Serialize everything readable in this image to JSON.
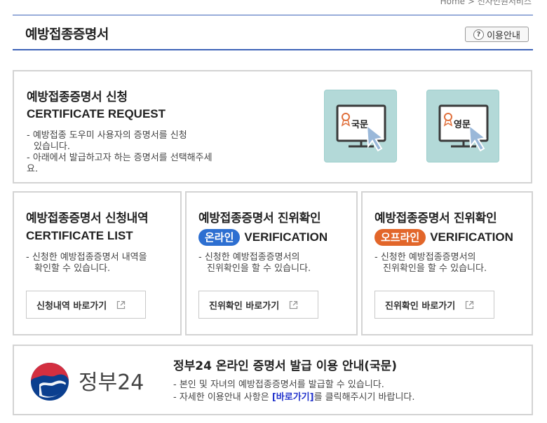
{
  "breadcrumb": "Home > 전자민원서비스",
  "page": {
    "title": "예방접종증명서",
    "guide_button": "이용안내",
    "guide_icon": "?"
  },
  "request": {
    "title": "예방접종증명서 신청",
    "title_en": "CERTIFICATE REQUEST",
    "desc_line1": "- 예방접종 도우미 사용자의 증명서를 신청",
    "desc_line1b": "  있습니다.",
    "desc_line2": "- 아래에서 발급하고자 하는 증명서를 선택해주세",
    "desc_line2b": "요.",
    "tiles": [
      {
        "label": "국문",
        "icon": "monitor-certificate-icon"
      },
      {
        "label": "영문",
        "icon": "monitor-certificate-icon"
      }
    ]
  },
  "cards": {
    "list": {
      "title": "예방접종증명서 신청내역",
      "title_en": "CERTIFICATE LIST",
      "desc_line1": "- 신청한 예방접종증명서 내역을",
      "desc_line2": "  확인할 수 있습니다.",
      "button": "신청내역 바로가기"
    },
    "online": {
      "title": "예방접종증명서 진위확인",
      "badge": "온라인",
      "title_en": "VERIFICATION",
      "desc_line1": "- 신청한 예방접종증명서의",
      "desc_line2": "  진위확인을 할 수 있습니다.",
      "button": "진위확인 바로가기"
    },
    "offline": {
      "title": "예방접종증명서 진위확인",
      "badge": "오프라인",
      "title_en": "VERIFICATION",
      "desc_line1": "- 신청한 예방접종증명서의",
      "desc_line2": "  진위확인을 할 수 있습니다.",
      "button": "진위확인 바로가기"
    }
  },
  "gov24": {
    "logo_text": "정부24",
    "title": "정부24 온라인 증명서 발급 이용 안내(국문)",
    "desc_line1": "- 본인 및 자녀의 예방접종증명서를 발급할 수 있습니다.",
    "desc_line2_pre": "- 자세한 이용안내 사항은 ",
    "desc_line2_link": "[바로가기]",
    "desc_line2_post": "를 클릭해주시기 바랍니다."
  },
  "colors": {
    "accent": "#3d63b8",
    "online_badge": "#2d6fd1",
    "offline_badge": "#e2662a",
    "tile_bg": "#b3d9d8",
    "link": "#2233cc"
  }
}
